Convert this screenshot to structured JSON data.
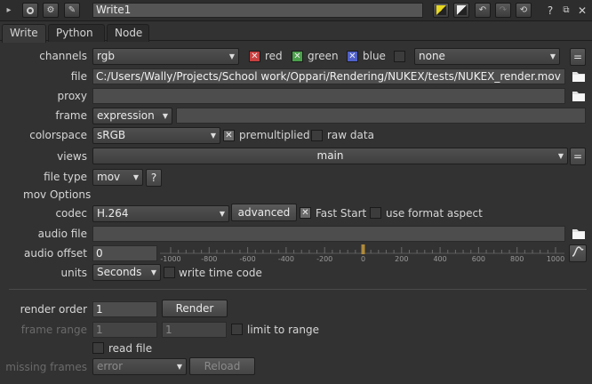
{
  "node_name": "Write1",
  "tabs": [
    "Write",
    "Python",
    "Node"
  ],
  "channels": {
    "label": "channels",
    "value": "rgb",
    "red": "red",
    "green": "green",
    "blue": "blue",
    "alpha": "none",
    "colors": {
      "red": "#c84040",
      "green": "#4aa04a",
      "blue": "#5060c8"
    }
  },
  "file": {
    "label": "file",
    "value": "C:/Users/Wally/Projects/School work/Oppari/Rendering/NUKEX/tests/NUKEX_render.mov"
  },
  "proxy": {
    "label": "proxy",
    "value": ""
  },
  "frame": {
    "label": "frame",
    "mode": "expression",
    "value": ""
  },
  "colorspace": {
    "label": "colorspace",
    "value": "sRGB",
    "premultiplied": "premultiplied",
    "raw_data": "raw data"
  },
  "views": {
    "label": "views",
    "value": "main"
  },
  "file_type": {
    "label": "file type",
    "value": "mov",
    "help": "?"
  },
  "mov_options": {
    "heading": "mov Options",
    "codec_label": "codec",
    "codec": "H.264",
    "advanced": "advanced",
    "fast_start": "Fast Start",
    "use_format_aspect": "use format aspect",
    "audio_file_label": "audio file",
    "audio_file": "",
    "audio_offset_label": "audio offset",
    "audio_offset": "0",
    "slider_ticks": [
      "-1000",
      "-800",
      "-600",
      "-400",
      "-200",
      "0",
      "200",
      "400",
      "600",
      "800",
      "1000"
    ],
    "slider_value": 0,
    "units_label": "units",
    "units": "Seconds",
    "write_time_code": "write time code"
  },
  "render": {
    "render_order_label": "render order",
    "render_order": "1",
    "render_button": "Render",
    "frame_range_label": "frame range",
    "frame_range_start": "1",
    "frame_range_end": "1",
    "limit_to_range": "limit to range",
    "read_file": "read file",
    "missing_frames_label": "missing frames",
    "missing_frames": "error",
    "reload_button": "Reload"
  },
  "toolbar_icons": [
    "panel-icon",
    "circle-icon",
    "node-icon",
    "wrench-icon",
    "yellow-swatch-icon",
    "split-icon",
    "undo-icon",
    "redo-icon",
    "revert-icon",
    "help-icon",
    "float-icon",
    "close-icon"
  ]
}
